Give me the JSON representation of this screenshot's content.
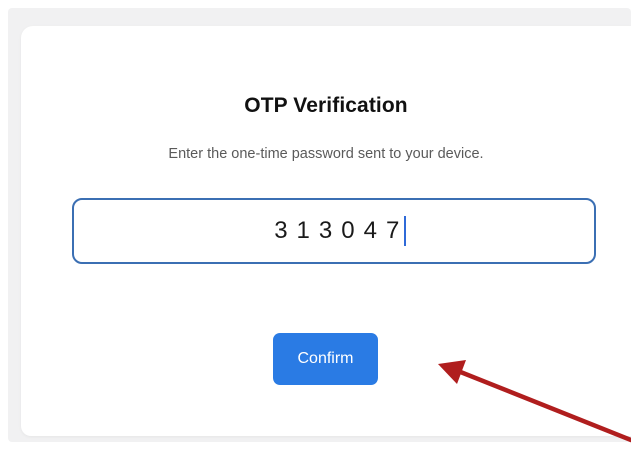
{
  "dialog": {
    "title": "OTP Verification",
    "subtitle": "Enter the one-time password sent to your device.",
    "otp_value": "313047",
    "confirm_label": "Confirm"
  },
  "colors": {
    "accent": "#2a7be4",
    "input_border": "#3b6fb3",
    "annotation_arrow": "#b01e1e"
  },
  "annotation": {
    "type": "arrow",
    "points_to": "confirm-button"
  }
}
